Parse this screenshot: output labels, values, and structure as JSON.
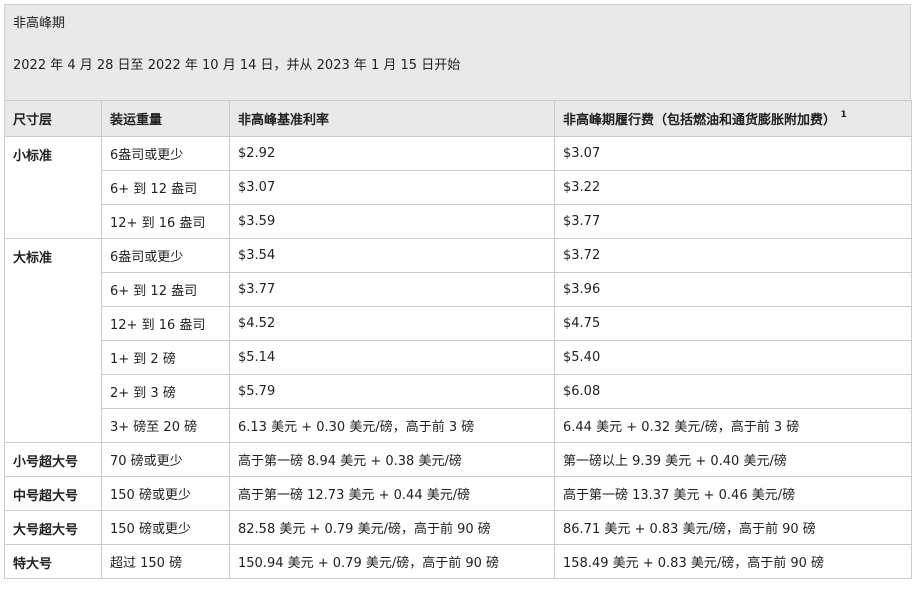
{
  "banner": {
    "title": "非高峰期",
    "subtitle": "2022 年 4 月 28 日至 2022 年 10 月 14 日，并从 2023 年 1 月 15 日开始"
  },
  "table": {
    "headers": {
      "tier": "尺寸层",
      "weight": "装运重量",
      "base": "非高峰基准利率",
      "fee": "非高峰期履行费（包括燃油和通货膨胀附加费）",
      "fee_sup": "1"
    },
    "groups": [
      {
        "tier": "小标准",
        "rows": [
          {
            "weight": "6盎司或更少",
            "base": "$2.92",
            "fee": "$3.07"
          },
          {
            "weight": "6+ 到 12 盎司",
            "base": "$3.07",
            "fee": "$3.22"
          },
          {
            "weight": "12+ 到 16 盎司",
            "base": "$3.59",
            "fee": "$3.77"
          }
        ]
      },
      {
        "tier": "大标准",
        "rows": [
          {
            "weight": "6盎司或更少",
            "base": "$3.54",
            "fee": "$3.72"
          },
          {
            "weight": "6+ 到 12 盎司",
            "base": "$3.77",
            "fee": "$3.96"
          },
          {
            "weight": "12+ 到 16 盎司",
            "base": "$4.52",
            "fee": "$4.75"
          },
          {
            "weight": "1+ 到 2 磅",
            "base": "$5.14",
            "fee": "$5.40"
          },
          {
            "weight": "2+ 到 3 磅",
            "base": "$5.79",
            "fee": "$6.08"
          },
          {
            "weight": "3+ 磅至 20 磅",
            "base": "6.13 美元 + 0.30 美元/磅，高于前 3 磅",
            "fee": "6.44 美元 + 0.32 美元/磅，高于前 3 磅"
          }
        ]
      },
      {
        "tier": "小号超大号",
        "rows": [
          {
            "weight": "70 磅或更少",
            "base": "高于第一磅 8.94 美元 + 0.38 美元/磅",
            "fee": "第一磅以上 9.39 美元 + 0.40 美元/磅"
          }
        ]
      },
      {
        "tier": "中号超大号",
        "rows": [
          {
            "weight": "150 磅或更少",
            "base": "高于第一磅 12.73 美元 + 0.44 美元/磅",
            "fee": "高于第一磅 13.37 美元 + 0.46 美元/磅"
          }
        ]
      },
      {
        "tier": "大号超大号",
        "rows": [
          {
            "weight": "150 磅或更少",
            "base": "82.58 美元 + 0.79 美元/磅，高于前 90 磅",
            "fee": "86.71 美元 + 0.83 美元/磅，高于前 90 磅"
          }
        ]
      },
      {
        "tier": "特大号",
        "rows": [
          {
            "weight": "超过 150 磅",
            "base": "150.94 美元 + 0.79 美元/磅，高于前 90 磅",
            "fee": "158.49 美元 + 0.83 美元/磅，高于前 90 磅"
          }
        ]
      }
    ]
  }
}
